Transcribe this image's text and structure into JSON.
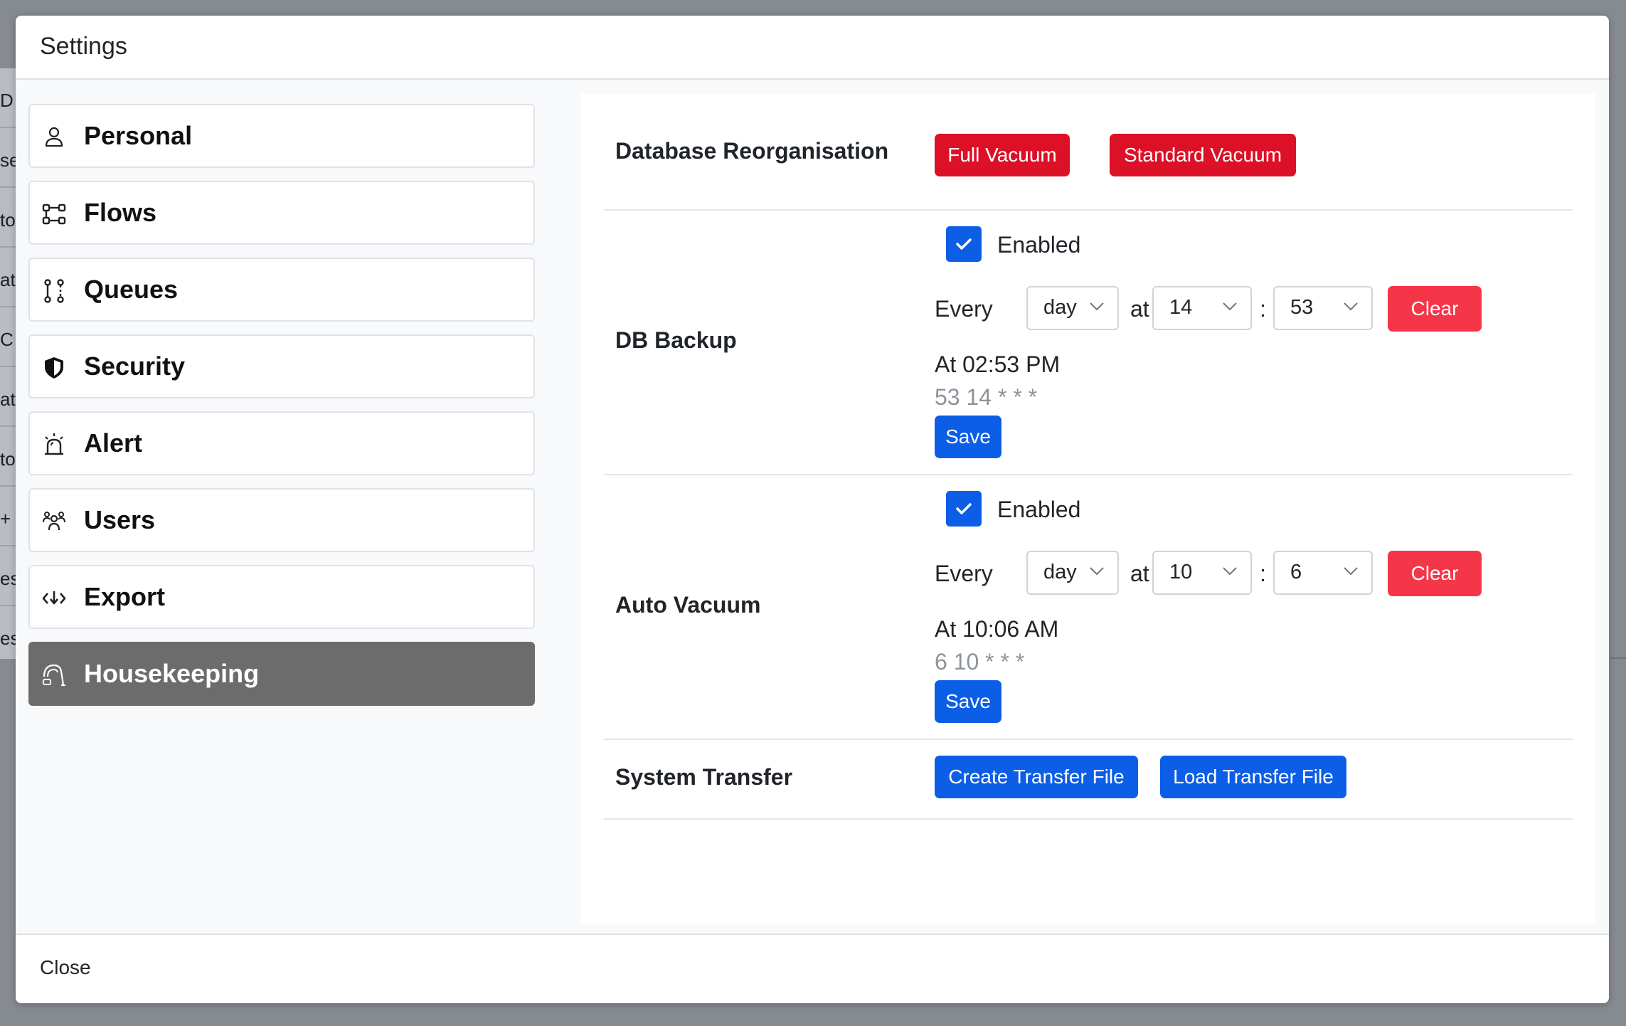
{
  "background": {
    "fragments": [
      "D",
      "se",
      "to",
      "at",
      "C",
      "at",
      "to",
      "+",
      "es",
      "es"
    ]
  },
  "modal": {
    "title": "Settings",
    "close_label": "Close"
  },
  "nav": {
    "items": [
      {
        "label": "Personal",
        "icon": "person-icon"
      },
      {
        "label": "Flows",
        "icon": "flows-icon"
      },
      {
        "label": "Queues",
        "icon": "queues-icon"
      },
      {
        "label": "Security",
        "icon": "shield-icon"
      },
      {
        "label": "Alert",
        "icon": "alarm-icon"
      },
      {
        "label": "Users",
        "icon": "users-icon"
      },
      {
        "label": "Export",
        "icon": "export-icon"
      },
      {
        "label": "Housekeeping",
        "icon": "vacuum-icon",
        "active": true
      }
    ]
  },
  "housekeeping": {
    "db_reorg": {
      "label": "Database Reorganisation",
      "full_vacuum_label": "Full Vacuum",
      "standard_vacuum_label": "Standard Vacuum"
    },
    "db_backup": {
      "label": "DB Backup",
      "enabled_label": "Enabled",
      "enabled": true,
      "every_label": "Every",
      "period": "day",
      "at_label": "at",
      "hour": "14",
      "colon": ":",
      "minute": "53",
      "clear_label": "Clear",
      "summary": "At 02:53 PM",
      "cron": "53 14 * * *",
      "save_label": "Save"
    },
    "auto_vacuum": {
      "label": "Auto Vacuum",
      "enabled_label": "Enabled",
      "enabled": true,
      "every_label": "Every",
      "period": "day",
      "at_label": "at",
      "hour": "10",
      "colon": ":",
      "minute": "6",
      "clear_label": "Clear",
      "summary": "At 10:06 AM",
      "cron": "6 10 * * *",
      "save_label": "Save"
    },
    "system_transfer": {
      "label": "System Transfer",
      "create_label": "Create Transfer File",
      "load_label": "Load Transfer File"
    }
  },
  "colors": {
    "danger_dark": "#dc1027",
    "danger": "#f53648",
    "primary": "#0d5ee6",
    "active_nav": "#6c6c6c"
  }
}
